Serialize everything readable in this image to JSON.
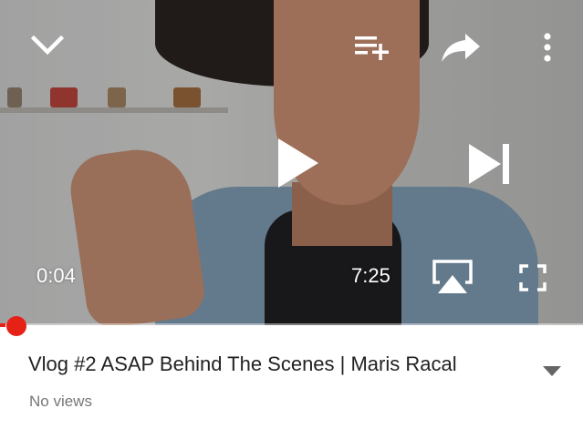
{
  "video": {
    "current_time": "0:04",
    "duration": "7:25",
    "progress_fraction": 0.009
  },
  "controls": {
    "top": [
      "minimize-chevron-icon",
      "add-to-playlist-icon",
      "share-icon",
      "more-options-icon"
    ],
    "center": [
      "play-icon",
      "next-icon"
    ],
    "bottom": [
      "airplay-icon",
      "fullscreen-icon"
    ]
  },
  "details": {
    "title": "Vlog #2 ASAP Behind The Scenes | Maris Racal",
    "views": "No views"
  },
  "colors": {
    "accent": "#e62117",
    "title_text": "#222222",
    "meta_text": "#777777"
  }
}
